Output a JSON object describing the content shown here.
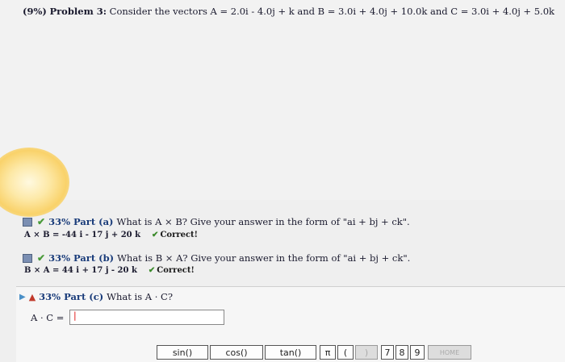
{
  "problem": {
    "prefix": "(9%)",
    "title": "Problem 3:",
    "statement": "Consider the vectors A = 2.0i - 4.0j + k and B = 3.0i + 4.0j + 10.0k and C = 3.0i + 4.0j + 5.0k"
  },
  "parts": [
    {
      "percent": "33%",
      "label": "Part (a)",
      "question": "What is A × B? Give your answer in the form of \"ai + bj + ck\".",
      "answer": "A × B = -44 i - 17 j + 20 k",
      "status": "Correct!"
    },
    {
      "percent": "33%",
      "label": "Part (b)",
      "question": "What is B × A? Give your answer in the form of \"ai + bj + ck\".",
      "answer": "B × A = 44 i + 17 j - 20 k",
      "status": "Correct!"
    },
    {
      "percent": "33%",
      "label": "Part (c)",
      "question": "What is A · C?",
      "input_label": "A · C =",
      "input_value": "|"
    }
  ],
  "keypad": {
    "sin": "sin()",
    "cos": "cos()",
    "tan": "tan()",
    "pi": "π",
    "lparen": "(",
    "rparen": ")",
    "seven": "7",
    "eight": "8",
    "nine": "9",
    "home": "HOME"
  }
}
